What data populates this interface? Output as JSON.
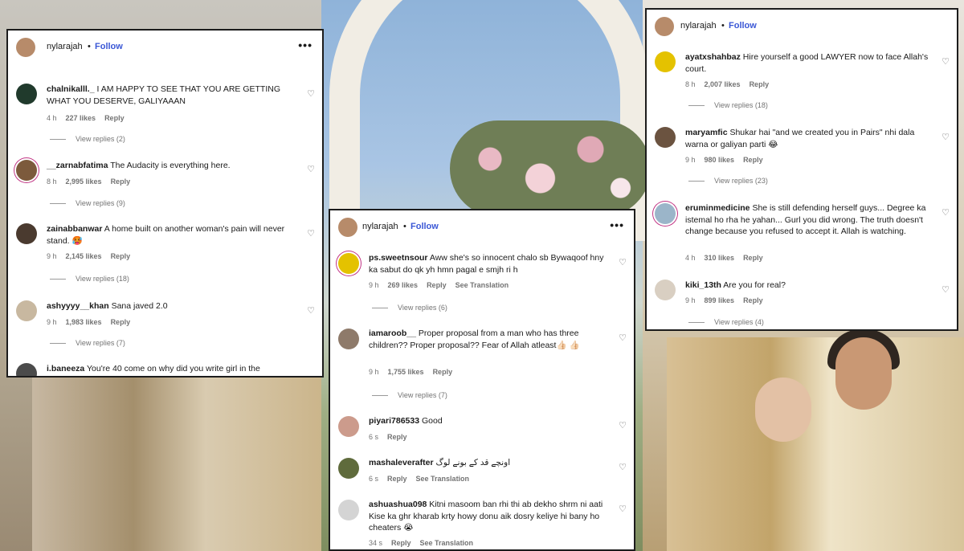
{
  "panel_left": {
    "header": {
      "username": "nylarajah",
      "separator": "•",
      "follow": "Follow",
      "more": "•••"
    },
    "comments": [
      {
        "user": "chalnikalll._",
        "text": "I AM HAPPY TO SEE THAT YOU ARE GETTING WHAT YOU DESERVE, GALIYAAAN",
        "time": "4 h",
        "likes": "227 likes",
        "reply": "Reply",
        "view_replies": "View replies (2)"
      },
      {
        "user": "__zarnabfatima",
        "text": "The Audacity is everything here.",
        "time": "8 h",
        "likes": "2,995 likes",
        "reply": "Reply",
        "view_replies": "View replies (9)"
      },
      {
        "user": "zainabbanwar",
        "text": "A home built on another woman's pain will never stand. 🥵",
        "time": "9 h",
        "likes": "2,145 likes",
        "reply": "Reply",
        "view_replies": "View replies (18)"
      },
      {
        "user": "ashyyyy__khan",
        "text": "Sana javed 2.0",
        "time": "9 h",
        "likes": "1,983 likes",
        "reply": "Reply",
        "view_replies": "View replies (7)"
      },
      {
        "user": "i.baneeza",
        "text": "You're 40 come on why did you write girl in the"
      }
    ]
  },
  "panel_center": {
    "header": {
      "username": "nylarajah",
      "separator": "•",
      "follow": "Follow",
      "more": "•••"
    },
    "comments": [
      {
        "user": "ps.sweetnsour",
        "text": "Aww she's so innocent chalo sb Bywaqoof hny ka sabut do qk yh hmn pagal e smjh ri h",
        "time": "9 h",
        "likes": "269 likes",
        "reply": "Reply",
        "translate": "See Translation",
        "view_replies": "View replies (6)"
      },
      {
        "user": "iamaroob__",
        "text": "Proper proposal from a man who has three children?? Proper proposal?? Fear of Allah atleast👍🏻 👍🏻",
        "time": "9 h",
        "likes": "1,755 likes",
        "reply": "Reply",
        "view_replies": "View replies (7)"
      },
      {
        "user": "piyari786533",
        "text": "Good",
        "time": "6 s",
        "reply": "Reply"
      },
      {
        "user": "mashaleverafter",
        "text": "اونچے قد کے بونے لوگ",
        "time": "6 s",
        "reply": "Reply",
        "translate": "See Translation"
      },
      {
        "user": "ashuashua098",
        "text": "Kitni masoom ban rhi thi ab dekho shrm ni aati Kise ka ghr kharab krty howy donu aik dosry keliye hi bany ho cheaters 😭",
        "time": "34 s",
        "reply": "Reply",
        "translate": "See Translation"
      }
    ]
  },
  "panel_right": {
    "header": {
      "username": "nylarajah",
      "separator": "•",
      "follow": "Follow"
    },
    "comments": [
      {
        "user": "ayatxshahbaz",
        "text": "Hire yourself a good LAWYER now to face Allah's court.",
        "time": "8 h",
        "likes": "2,007 likes",
        "reply": "Reply",
        "view_replies": "View replies (18)"
      },
      {
        "user": "maryamfic",
        "text": "Shukar hai \"and we created you in Pairs\" nhi dala warna or galiyan parti 😂",
        "time": "9 h",
        "likes": "980 likes",
        "reply": "Reply",
        "view_replies": "View replies (23)"
      },
      {
        "user": "eruminmedicine",
        "text": "She is still defending herself guys... Degree ka istemal ho rha he yahan... Gurl you did wrong. The truth doesn't change because you refused to accept it. Allah is watching.",
        "time": "4 h",
        "likes": "310 likes",
        "reply": "Reply"
      },
      {
        "user": "kiki_13th",
        "text": "Are you for real?",
        "time": "9 h",
        "likes": "899 likes",
        "reply": "Reply",
        "view_replies": "View replies (4)"
      }
    ]
  },
  "icons": {
    "heart": "heart-outline-icon",
    "heart_glyph": "♡"
  },
  "colors": {
    "follow": "#3a57d6",
    "meta": "#737373",
    "story_ring": "#c13584"
  }
}
